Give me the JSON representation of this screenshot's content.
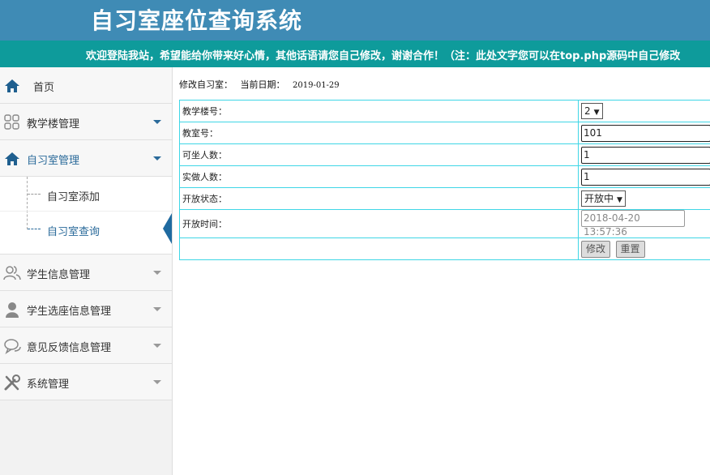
{
  "header": {
    "title": "自习室座位查询系统"
  },
  "marquee": {
    "text": "欢迎登陆我站，希望能给你带来好心情，其他话语请您自己修改，谢谢合作！（注：此处文字您可以在top.php源码中自己修改"
  },
  "sidebar": {
    "home": {
      "label": "首页",
      "icon": "home-icon"
    },
    "items": [
      {
        "label": "教学楼管理",
        "icon": "grid-icon"
      },
      {
        "label": "自习室管理",
        "icon": "home-icon",
        "expanded": true
      },
      {
        "label": "学生信息管理",
        "icon": "users-icon"
      },
      {
        "label": "学生选座信息管理",
        "icon": "user-icon"
      },
      {
        "label": "意见反馈信息管理",
        "icon": "chat-icon"
      },
      {
        "label": "系统管理",
        "icon": "tools-icon"
      }
    ],
    "submenu": [
      {
        "label": "自习室添加"
      },
      {
        "label": "自习室查询",
        "active": true
      }
    ],
    "accent_color": "#2a6a9a"
  },
  "content": {
    "breadcrumb": "修改自习室：",
    "date_label": "当前日期：",
    "date_value": "2019-01-29",
    "form": {
      "building_label": "教学楼号：",
      "building_value": "2",
      "room_label": "教室号：",
      "room_value": "101",
      "capacity_label": "可坐人数：",
      "capacity_value": "1",
      "actual_label": "实做人数：",
      "actual_value": "1",
      "status_label": "开放状态：",
      "status_value": "开放中",
      "time_label": "开放时间：",
      "time_value": "2018-04-20 13:57:36",
      "submit_label": "修改",
      "reset_label": "重置"
    }
  },
  "colors": {
    "header": "#3f8bb5",
    "marquee": "#0e9b9b",
    "table_border": "#3fd6e6"
  }
}
